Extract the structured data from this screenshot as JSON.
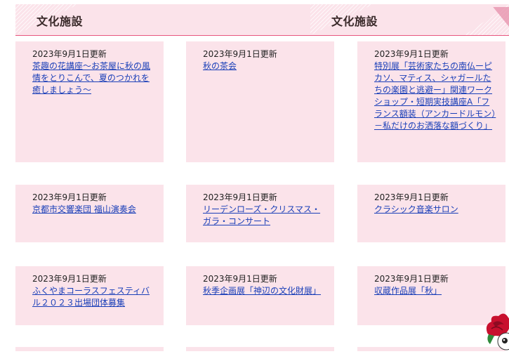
{
  "header": {
    "title_left": "文化施設",
    "title_right": "文化施設"
  },
  "cards": [
    {
      "date": "2023年9月1日更新",
      "link": "茶趣の花講座～お茶屋に秋の風情をとりこんで、夏のつかれを癒しましょう～"
    },
    {
      "date": "2023年9月1日更新",
      "link": "秋の茶会"
    },
    {
      "date": "2023年9月1日更新",
      "link": "特別展「芸術家たちの南仏ーピカソ、マティス、シャガールたちの楽園と逃避ー」関連ワークショップ・短期実技講座A「フランス額装（アンカードルモン）－私だけのお洒落な額づくり」"
    },
    {
      "date": "2023年9月1日更新",
      "link": "京都市交響楽団 福山演奏会"
    },
    {
      "date": "2023年9月1日更新",
      "link": "リーデンローズ・クリスマス・ガラ・コンサート"
    },
    {
      "date": "2023年9月1日更新",
      "link": "クラシック音楽サロン"
    },
    {
      "date": "2023年9月1日更新",
      "link": "ふくやまコーラスフェスティバル２０２３出場団体募集"
    },
    {
      "date": "2023年9月1日更新",
      "link": "秋季企画展「神辺の文化財展」"
    },
    {
      "date": "2023年9月1日更新",
      "link": "収蔵作品展「秋」"
    }
  ],
  "colors": {
    "card_bg": "#fbe3ea",
    "accent_line": "#e8577f",
    "link": "#1a3fb8"
  },
  "icons": [
    "rose-mascot-icon"
  ]
}
